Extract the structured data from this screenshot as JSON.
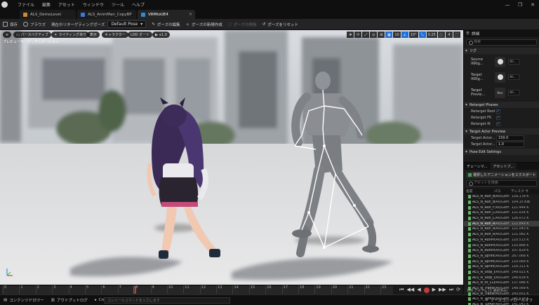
{
  "menubar": {
    "items": [
      "ファイル",
      "編集",
      "アセット",
      "ウィンドウ",
      "ツール",
      "ヘルプ"
    ],
    "window_controls": [
      "—",
      "❐",
      "✕"
    ]
  },
  "tabs": [
    {
      "label": "ALS_DemoLevel"
    },
    {
      "label": "ALS_AnimMan_CopyBP"
    },
    {
      "label": "VRMtoUE4"
    }
  ],
  "toolbar": {
    "save": "保存",
    "browse": "ブラウズ",
    "retarget_pose_label": "現在のリターゲティングポーズ",
    "pose_select": "Default Pose",
    "edit_pose": "ポーズの編集",
    "new_pose": "ポーズの新規作成",
    "delete_pose": "ポーズの削除",
    "reset_pose": "ポーズをリセット"
  },
  "viewport": {
    "perspective": "パースペクティブ",
    "lighting": "ライティングあり",
    "show": "表示",
    "character": "キャラクター",
    "lod": "LOD オート",
    "speed": "x1.0",
    "status": "プレビューモード : アニメーション",
    "right_controls": [
      "10",
      "10°",
      "0.25",
      "4"
    ]
  },
  "timeline": {
    "ticks": [
      "0",
      "1",
      "2",
      "3",
      "4",
      "5",
      "6",
      "7",
      "8",
      "9",
      "10",
      "11",
      "12",
      "13",
      "14",
      "15",
      "16",
      "17",
      "18",
      "19",
      "20",
      "21",
      "22",
      "23"
    ],
    "current_frame": 8,
    "max_frame": 24,
    "controls": [
      "⏮",
      "◀◀",
      "◀",
      "●",
      "▶",
      "▶▶",
      "⏭",
      "⟳"
    ]
  },
  "statusbar": {
    "content_drawer": "コンテンツドロワー",
    "output_log": "アウトプットログ",
    "cmd": "Cmd",
    "cmd_placeholder": "コンソールコマンドを入力します",
    "source_control": "ソースコントロールオフ"
  },
  "details": {
    "title": "詳細",
    "search_placeholder": "検索",
    "section_ik": "リグ",
    "source_ik": "Source IKRig...",
    "target_ik": "Target IKRig...",
    "target_preview": "Target Previe...",
    "target_preview_value": "Non",
    "retarget_phases": "Retarget Phases",
    "phase_root": "Retarget Root",
    "phase_fk": "Retarget FK",
    "phase_ik": "Retarget IK",
    "target_actor_preview": "Target Actor Preview",
    "target_actor_offset": "Target Actor...",
    "target_actor_offset_value": "150.0",
    "target_actor_scale": "Target Actor...",
    "target_actor_scale_value": "1.0",
    "pose_edit_settings": "Pose Edit Settings",
    "dd_short": "Ali..."
  },
  "assets": {
    "tab1": "チェーンマ...",
    "tab2": "アセットブ...",
    "export_button": "選択したアニメーションをエクスポート",
    "search_placeholder": "アセットを検索",
    "columns": [
      "名前",
      "パス",
      "ディスク サ"
    ],
    "rows": [
      {
        "name": "ALS_N_Run_B",
        "path": "/All/Gam",
        "size": "116.178 K"
      },
      {
        "name": "ALS_N_Run_Bu",
        "path": "/All/Gam",
        "size": "104.15 KiB"
      },
      {
        "name": "ALS_N_Run_F",
        "path": "/All/Gam",
        "size": "121.444 K"
      },
      {
        "name": "ALS_N_Run_LB",
        "path": "/All/Gam",
        "size": "121.014 K"
      },
      {
        "name": "ALS_N_Run_LF",
        "path": "/All/Gam",
        "size": "126.072 K"
      },
      {
        "name": "ALS_N_Run_RB",
        "path": "/All/Gam",
        "size": "122.849 K"
      },
      {
        "name": "ALS_N_Run_RF",
        "path": "/All/Gam",
        "size": "121.043 K"
      },
      {
        "name": "ALS_N_Run_RR",
        "path": "/All/Gam",
        "size": "121.082 K"
      },
      {
        "name": "ALS_N_RunPiv",
        "path": "/All/Gam",
        "size": "110.513 K"
      },
      {
        "name": "ALS_N_RunPiv",
        "path": "/All/Gam",
        "size": "110.868 K"
      },
      {
        "name": "ALS_N_RunPiv",
        "path": "/All/Gam",
        "size": "107.829 K"
      },
      {
        "name": "ALS_N_Sprint",
        "path": "/All/Gam",
        "size": "267.068 K"
      },
      {
        "name": "ALS_N_Sprint_",
        "path": "/All/Gam",
        "size": "110.069 K"
      },
      {
        "name": "ALS_N_Sprint_",
        "path": "/All/Gam",
        "size": "116.311 K"
      },
      {
        "name": "ALS_N_Stop_L",
        "path": "/All/Gam",
        "size": "149.021 K"
      },
      {
        "name": "ALS_N_Stop_R",
        "path": "/All/Gam",
        "size": "148.639 K"
      },
      {
        "name": "ALS_N_to_CLF",
        "path": "/All/Gam",
        "size": "137.086 K"
      },
      {
        "name": "ALS_N_Transit",
        "path": "/All/Gam",
        "size": "148.569 K"
      },
      {
        "name": "ALS_N_Transit",
        "path": "/All/Gam",
        "size": "143.051 K"
      },
      {
        "name": "ALS_N_TurnIP",
        "path": "/All/Gam",
        "size": "145.618 K"
      },
      {
        "name": "ALS_N_TurnIP",
        "path": "/All/Gam",
        "size": "141.043 K"
      }
    ],
    "selected_index": 5,
    "count": "166 アイテム (1 選択済み)"
  }
}
